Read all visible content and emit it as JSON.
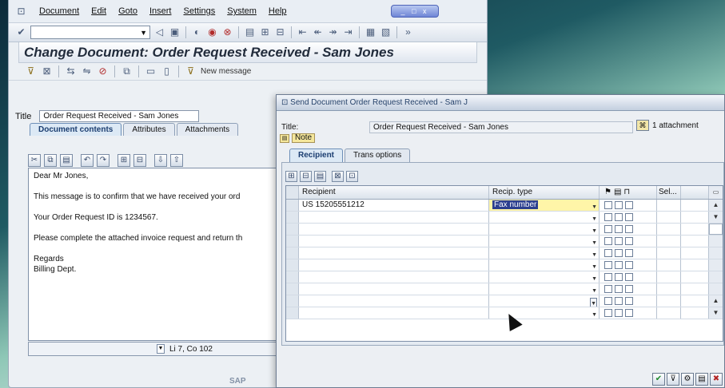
{
  "menu": [
    "Document",
    "Edit",
    "Goto",
    "Insert",
    "Settings",
    "System",
    "Help"
  ],
  "window_controls": "_ □ x",
  "toolbar": {
    "check_icon": "checkmark-icon",
    "overflow": "»"
  },
  "page_title": "Change Document: Order Request Received - Sam Jones",
  "app_toolbar": {
    "new_message": "New message"
  },
  "document": {
    "title_label": "Title",
    "title_value": "Order Request Received - Sam Jones",
    "tabs": [
      "Document contents",
      "Attributes",
      "Attachments"
    ],
    "body_lines": [
      "Dear Mr Jones,",
      "",
      "This message is to confirm that we have received your ord",
      "",
      "Your Order Request ID is 1234567.",
      "",
      "Please complete the attached invoice request and return th",
      "",
      "Regards",
      "Billing Dept."
    ],
    "status": "Li 7, Co 102",
    "footer_logo": "SAP"
  },
  "dialog": {
    "title": "Send Document Order Request Received - Sam J",
    "title_label": "Title:",
    "title_value": "Order Request Received - Sam Jones",
    "attachment_text": "1 attachment",
    "note_label": "Note",
    "tabs": [
      "Recipient",
      "Trans options"
    ],
    "columns": {
      "recipient": "Recipient",
      "recip_type": "Recip. type",
      "sel": "Sel..."
    },
    "rows": [
      {
        "recipient": "US 15205551212",
        "type": "Fax number"
      },
      {
        "recipient": "",
        "type": ""
      },
      {
        "recipient": "",
        "type": ""
      },
      {
        "recipient": "",
        "type": ""
      },
      {
        "recipient": "",
        "type": ""
      },
      {
        "recipient": "",
        "type": ""
      },
      {
        "recipient": "",
        "type": ""
      },
      {
        "recipient": "",
        "type": ""
      },
      {
        "recipient": "",
        "type": ""
      },
      {
        "recipient": "",
        "type": ""
      }
    ]
  }
}
